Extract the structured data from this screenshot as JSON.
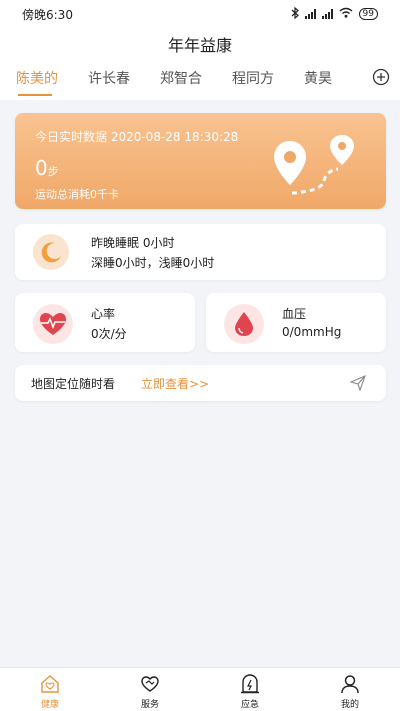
{
  "status_bar": {
    "time": "傍晚6:30",
    "signal1": "HD 4G",
    "signal2": "HD 4G",
    "battery": "99"
  },
  "header": {
    "title": "年年益康"
  },
  "tabs": [
    {
      "label": "陈美的",
      "active": true
    },
    {
      "label": "许长春",
      "active": false
    },
    {
      "label": "郑智合",
      "active": false
    },
    {
      "label": "程同方",
      "active": false
    },
    {
      "label": "黄昊",
      "active": false
    }
  ],
  "steps_card": {
    "date_text": "今日实时数据 2020-08-28 18:30:28",
    "steps_value": "0",
    "steps_unit": "步",
    "calories_text": "运动总消耗0千卡"
  },
  "sleep_card": {
    "line1": "昨晚睡眠 0小时",
    "line2": "深睡0小时，浅睡0小时"
  },
  "heart_rate": {
    "label": "心率",
    "value": "0次/分"
  },
  "blood_pressure": {
    "label": "血压",
    "value": "0/0mmHg"
  },
  "map_card": {
    "text": "地图定位随时看",
    "link": "立即查看>>"
  },
  "bottom_nav": [
    {
      "label": "健康",
      "icon": "home-health-icon",
      "active": true
    },
    {
      "label": "服务",
      "icon": "handshake-icon",
      "active": false
    },
    {
      "label": "应急",
      "icon": "emergency-icon",
      "active": false
    },
    {
      "label": "我的",
      "icon": "user-icon",
      "active": false
    }
  ],
  "colors": {
    "accent": "#e8923a",
    "card_gradient_top": "#f9c391",
    "card_gradient_bottom": "#f0a868",
    "heart_red": "#e0454f"
  }
}
